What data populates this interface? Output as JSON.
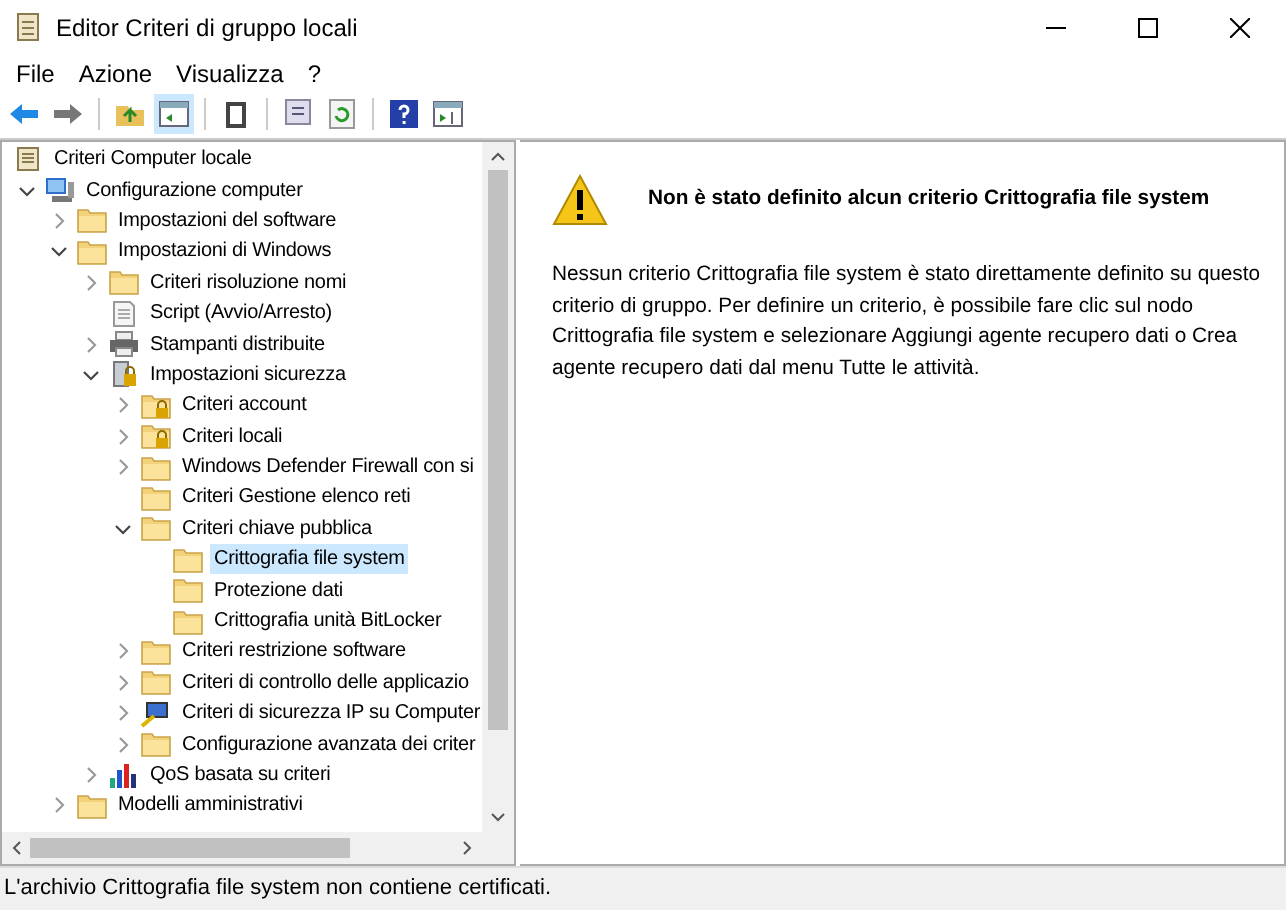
{
  "window": {
    "title": "Editor Criteri di gruppo locali"
  },
  "menu": [
    "File",
    "Azione",
    "Visualizza",
    "?"
  ],
  "toolbar": [
    {
      "kind": "back",
      "selected": false
    },
    {
      "kind": "forward",
      "selected": false
    },
    {
      "kind": "up",
      "selected": false
    },
    {
      "kind": "tree",
      "selected": true
    },
    {
      "kind": "clipboard",
      "selected": false
    },
    {
      "kind": "export",
      "selected": false
    },
    {
      "kind": "refresh",
      "selected": false
    },
    {
      "kind": "help",
      "selected": false
    },
    {
      "kind": "pane",
      "selected": false
    }
  ],
  "tree": [
    {
      "label": "Criteri Computer locale",
      "kind": "root",
      "selected": false,
      "children": [
        {
          "label": "Configurazione computer",
          "kind": "computer",
          "expanded": true,
          "selected": false,
          "children": [
            {
              "label": "Impostazioni del software",
              "kind": "folder",
              "expanded": false,
              "selected": false
            },
            {
              "label": "Impostazioni di Windows",
              "kind": "folder",
              "expanded": true,
              "selected": false,
              "children": [
                {
                  "label": "Criteri risoluzione nomi",
                  "kind": "folder",
                  "expanded": false,
                  "selected": false
                },
                {
                  "label": "Script (Avvio/Arresto)",
                  "kind": "script",
                  "selected": false
                },
                {
                  "label": "Stampanti distribuite",
                  "kind": "printer",
                  "expanded": false,
                  "selected": false
                },
                {
                  "label": "Impostazioni sicurezza",
                  "kind": "security",
                  "expanded": true,
                  "selected": false,
                  "children": [
                    {
                      "label": "Criteri account",
                      "kind": "folder-lock",
                      "expanded": false,
                      "selected": false
                    },
                    {
                      "label": "Criteri locali",
                      "kind": "folder-lock",
                      "expanded": false,
                      "selected": false
                    },
                    {
                      "label": "Windows Defender Firewall con si",
                      "kind": "folder",
                      "expanded": false,
                      "selected": false
                    },
                    {
                      "label": "Criteri Gestione elenco reti",
                      "kind": "folder",
                      "selected": false
                    },
                    {
                      "label": "Criteri chiave pubblica",
                      "kind": "folder",
                      "expanded": true,
                      "selected": false,
                      "children": [
                        {
                          "label": "Crittografia file system",
                          "kind": "folder",
                          "selected": true
                        },
                        {
                          "label": "Protezione dati",
                          "kind": "folder",
                          "selected": false
                        },
                        {
                          "label": "Crittografia unità BitLocker",
                          "kind": "folder",
                          "selected": false
                        }
                      ]
                    },
                    {
                      "label": "Criteri restrizione software",
                      "kind": "folder",
                      "expanded": false,
                      "selected": false
                    },
                    {
                      "label": "Criteri di controllo delle applicazio",
                      "kind": "folder",
                      "expanded": false,
                      "selected": false
                    },
                    {
                      "label": "Criteri di sicurezza IP su Computer",
                      "kind": "ip",
                      "expanded": false,
                      "selected": false
                    },
                    {
                      "label": "Configurazione avanzata dei criter",
                      "kind": "folder",
                      "expanded": false,
                      "selected": false
                    }
                  ]
                },
                {
                  "label": "QoS basata su criteri",
                  "kind": "qos",
                  "expanded": false,
                  "selected": false
                }
              ]
            },
            {
              "label": "Modelli amministrativi",
              "kind": "folder",
              "expanded": false,
              "selected": false
            }
          ]
        }
      ]
    }
  ],
  "detail": {
    "heading": "Non è stato definito alcun criterio Crittografia file system",
    "text": "Nessun criterio Crittografia file system è stato direttamente definito su questo criterio di gruppo. Per definire un criterio, è possibile fare clic sul nodo Crittografia file system e selezionare Aggiungi agente recupero dati o Crea agente recupero dati dal menu Tutte le attività."
  },
  "status_bar": "L'archivio Crittografia file system non contiene certificati."
}
